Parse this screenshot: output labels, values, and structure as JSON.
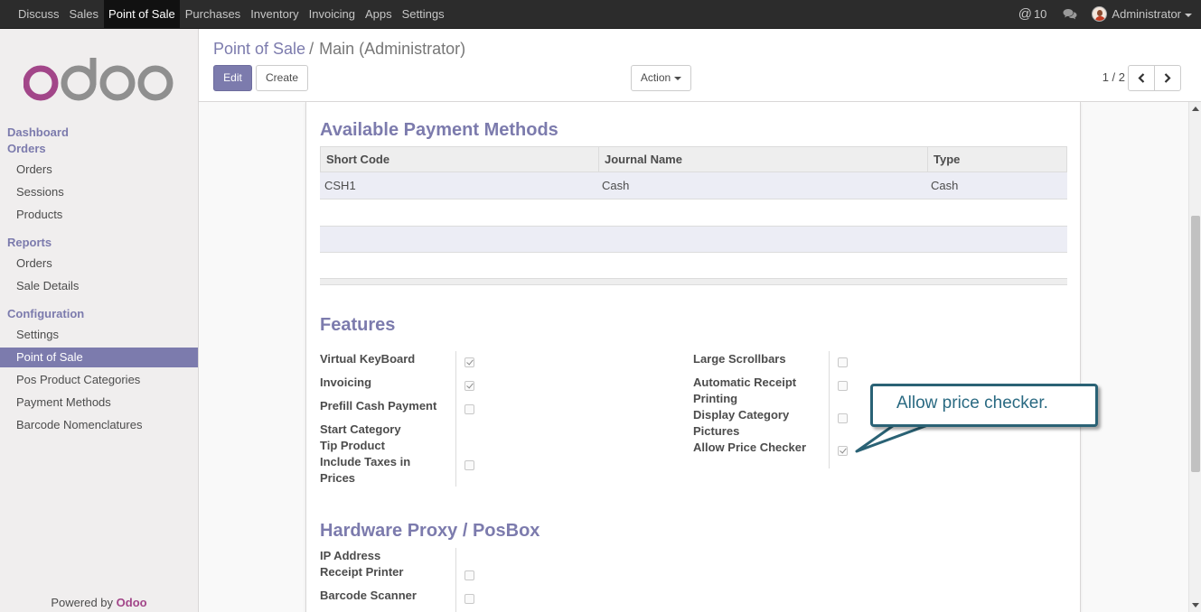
{
  "topbar": {
    "menu": [
      "Discuss",
      "Sales",
      "Point of Sale",
      "Purchases",
      "Inventory",
      "Invoicing",
      "Apps",
      "Settings"
    ],
    "active_menu": "Point of Sale",
    "mentions_count": "10",
    "user_name": "Administrator",
    "bar_color": "#2c2c2c"
  },
  "sidebar": {
    "sections": [
      {
        "title": "Dashboard",
        "items": []
      },
      {
        "title": "Orders",
        "items": [
          "Orders",
          "Sessions",
          "Products"
        ]
      },
      {
        "title": "Reports",
        "items": [
          "Orders",
          "Sale Details"
        ]
      },
      {
        "title": "Configuration",
        "items": [
          "Settings",
          "Point of Sale",
          "Pos Product Categories",
          "Payment Methods",
          "Barcode Nomenclatures"
        ]
      }
    ],
    "active_item": "Point of Sale",
    "powered_prefix": "Powered by",
    "powered_brand": "Odoo"
  },
  "control_panel": {
    "breadcrumb_parent": "Point of Sale",
    "breadcrumb_sep": "/",
    "breadcrumb_current": "Main (Administrator)",
    "edit_label": "Edit",
    "create_label": "Create",
    "action_label": "Action",
    "pager": "1 / 2"
  },
  "form": {
    "payment_section_title": "Available Payment Methods",
    "payment_columns": [
      "Short Code",
      "Journal Name",
      "Type"
    ],
    "payment_rows": [
      {
        "short_code": "CSH1",
        "journal_name": "Cash",
        "type": "Cash"
      }
    ],
    "features_title": "Features",
    "features_left": [
      {
        "label": "Virtual KeyBoard",
        "checked": true
      },
      {
        "label": "Invoicing",
        "checked": true
      },
      {
        "label": "Prefill Cash Payment",
        "checked": false
      },
      {
        "label": "Start Category",
        "checked": null
      },
      {
        "label": "Tip Product",
        "checked": null
      },
      {
        "label": "Include Taxes in Prices",
        "checked": false
      }
    ],
    "features_right": [
      {
        "label": "Large Scrollbars",
        "checked": false
      },
      {
        "label": "Automatic Receipt Printing",
        "checked": false
      },
      {
        "label": "Display Category Pictures",
        "checked": false
      },
      {
        "label": "Allow Price Checker",
        "checked": true
      }
    ],
    "hardware_title": "Hardware Proxy / PosBox",
    "hardware_fields": [
      {
        "label": "IP Address",
        "checked": null
      },
      {
        "label": "Receipt Printer",
        "checked": false
      },
      {
        "label": "Barcode Scanner",
        "checked": false
      }
    ]
  },
  "callout": {
    "text": "Allow price checker.",
    "border_color": "#2a6275"
  },
  "colors": {
    "accent": "#7c7bad",
    "brand": "#a24689"
  }
}
